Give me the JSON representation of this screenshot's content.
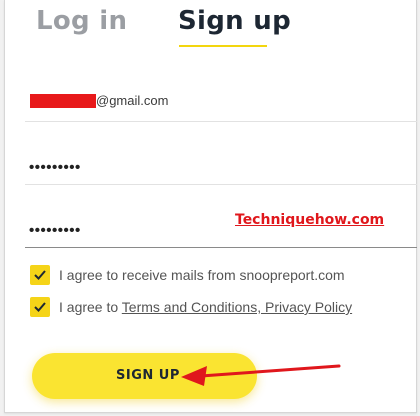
{
  "tabs": {
    "login_label": "Log in",
    "signup_label": "Sign up",
    "active": "Sign up"
  },
  "form": {
    "email_value_visible": "@gmail.com",
    "password_value": "•••••••••",
    "confirm_password_value": "•••••••••"
  },
  "watermark": "Techniquehow.com",
  "checkboxes": {
    "mails_label": "I agree to receive mails from snoopreport.com",
    "mails_checked": true,
    "terms_prefix": "I agree to ",
    "terms_link": "Terms and Conditions, Privacy Policy",
    "terms_checked": true
  },
  "submit": {
    "label": "SIGN UP"
  },
  "colors": {
    "accent": "#f5d418",
    "redaction": "#e8191a",
    "annotation_arrow": "#e0171c"
  }
}
